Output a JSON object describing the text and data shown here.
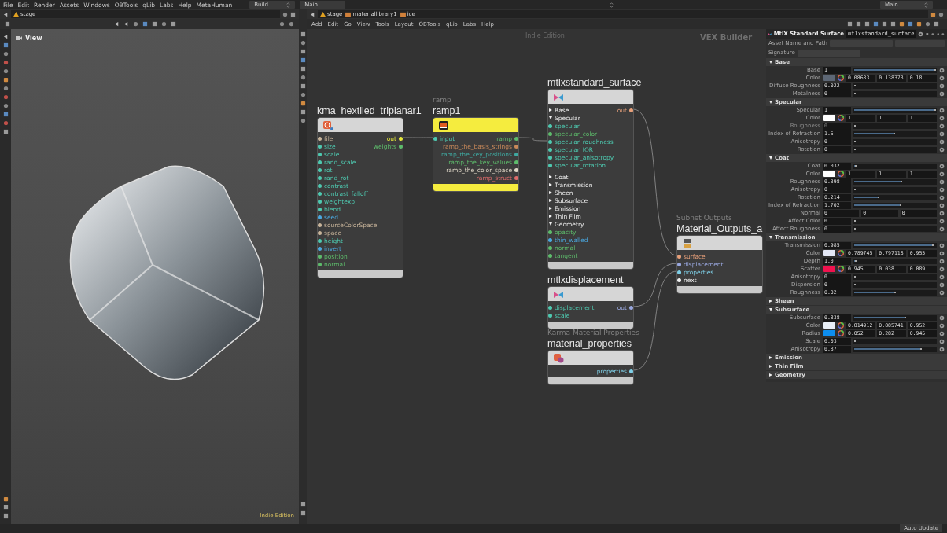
{
  "menu_bar": {
    "items": [
      "File",
      "Edit",
      "Render",
      "Assets",
      "Windows",
      "OBTools",
      "qLib",
      "Labs",
      "Help",
      "MetaHuman"
    ],
    "desktop": "Build",
    "pane_tab": "Main",
    "right_pane_tab": "Main"
  },
  "viewport": {
    "path": "stage",
    "title": "View",
    "edition": "Indie Edition"
  },
  "network": {
    "path": [
      "stage",
      "materiallibrary1",
      "ice"
    ],
    "menu": [
      "Add",
      "Edit",
      "Go",
      "View",
      "Tools",
      "Layout",
      "OBTools",
      "qLib",
      "Labs",
      "Help"
    ],
    "edition": "Indie Edition",
    "context": "VEX Builder",
    "nodes": [
      {
        "kind": "texture",
        "name": "kma_hextiled_triplanar1",
        "rows": [
          {
            "kind": "port",
            "input": {
              "label": "file",
              "color": "#c8b49a"
            },
            "output": {
              "label": "out",
              "color": "#e5e83a"
            }
          },
          {
            "kind": "port",
            "input": {
              "label": "size",
              "color": "#4ec9b0"
            },
            "output": {
              "label": "weights",
              "color": "#5dbb6b"
            }
          },
          {
            "kind": "port",
            "input": {
              "label": "scale",
              "color": "#4ec9b0"
            }
          },
          {
            "kind": "port",
            "input": {
              "label": "rand_scale",
              "color": "#4ec9b0"
            }
          },
          {
            "kind": "port",
            "input": {
              "label": "rot",
              "color": "#4ec9b0"
            }
          },
          {
            "kind": "port",
            "input": {
              "label": "rand_rot",
              "color": "#4ec9b0"
            }
          },
          {
            "kind": "port",
            "input": {
              "label": "contrast",
              "color": "#4ec9b0"
            }
          },
          {
            "kind": "port",
            "input": {
              "label": "contrast_falloff",
              "color": "#4ec9b0"
            }
          },
          {
            "kind": "port",
            "input": {
              "label": "weightexp",
              "color": "#4ec9b0"
            }
          },
          {
            "kind": "port",
            "input": {
              "label": "blend",
              "color": "#4ec9b0"
            }
          },
          {
            "kind": "port",
            "input": {
              "label": "seed",
              "color": "#4aa8e0"
            }
          },
          {
            "kind": "port",
            "input": {
              "label": "sourceColorSpace",
              "color": "#c8b49a"
            }
          },
          {
            "kind": "port",
            "input": {
              "label": "space",
              "color": "#c8b49a"
            }
          },
          {
            "kind": "port",
            "input": {
              "label": "height",
              "color": "#4ec9b0"
            }
          },
          {
            "kind": "port",
            "input": {
              "label": "invert",
              "color": "#4aa8e0"
            }
          },
          {
            "kind": "port",
            "input": {
              "label": "position",
              "color": "#5dbb6b"
            }
          },
          {
            "kind": "port",
            "input": {
              "label": "normal",
              "color": "#5dbb6b"
            }
          }
        ]
      },
      {
        "kind": "ramp",
        "subtitle": "ramp",
        "name": "ramp1",
        "color": "#f5ec3e",
        "rows": [
          {
            "kind": "port",
            "input": {
              "label": "input",
              "color": "#4ec9b0"
            },
            "output": {
              "label": "ramp",
              "color": "#5dbb6b"
            }
          },
          {
            "kind": "port",
            "output": {
              "label": "ramp_the_basis_strings",
              "color": "#c8895a"
            }
          },
          {
            "kind": "port",
            "output": {
              "label": "ramp_the_key_positions",
              "color": "#3fa8a0"
            }
          },
          {
            "kind": "port",
            "output": {
              "label": "ramp_the_key_values",
              "color": "#5dbb6b"
            }
          },
          {
            "kind": "port",
            "output": {
              "label": "ramp_the_color_space",
              "color": "#e0d8c8"
            }
          },
          {
            "kind": "port",
            "output": {
              "label": "ramp_struct",
              "color": "#e06c6c"
            }
          }
        ]
      },
      {
        "kind": "materialx",
        "name": "mtlxstandard_surface",
        "rows": [
          {
            "kind": "section",
            "label": "Base",
            "expanded": false,
            "output": {
              "label": "out",
              "color": "#e8a07a"
            }
          },
          {
            "kind": "section",
            "label": "Specular",
            "expanded": true
          },
          {
            "kind": "port",
            "input": {
              "label": "specular",
              "color": "#4ec9b0"
            }
          },
          {
            "kind": "port",
            "input": {
              "label": "specular_color",
              "color": "#5dbb6b"
            }
          },
          {
            "kind": "port",
            "input": {
              "label": "specular_roughness",
              "color": "#4ec9b0"
            }
          },
          {
            "kind": "port",
            "input": {
              "label": "specular_IOR",
              "color": "#4ec9b0"
            }
          },
          {
            "kind": "port",
            "input": {
              "label": "specular_anisotropy",
              "color": "#4ec9b0"
            }
          },
          {
            "kind": "port",
            "input": {
              "label": "specular_rotation",
              "color": "#4ec9b0"
            }
          },
          {
            "kind": "section",
            "label": "Coat",
            "expanded": false
          },
          {
            "kind": "section",
            "label": "Transmission",
            "expanded": false
          },
          {
            "kind": "section",
            "label": "Sheen",
            "expanded": false
          },
          {
            "kind": "section",
            "label": "Subsurface",
            "expanded": false
          },
          {
            "kind": "section",
            "label": "Emission",
            "expanded": false
          },
          {
            "kind": "section",
            "label": "Thin Film",
            "expanded": false
          },
          {
            "kind": "section",
            "label": "Geometry",
            "expanded": true
          },
          {
            "kind": "port",
            "input": {
              "label": "opacity",
              "color": "#5dbb6b"
            }
          },
          {
            "kind": "port",
            "input": {
              "label": "thin_walled",
              "color": "#4aa8e0"
            }
          },
          {
            "kind": "port",
            "input": {
              "label": "normal",
              "color": "#5dbb6b"
            }
          },
          {
            "kind": "port",
            "input": {
              "label": "tangent",
              "color": "#5dbb6b"
            }
          }
        ]
      },
      {
        "kind": "materialx",
        "name": "mtlxdisplacement",
        "rows": [
          {
            "kind": "port",
            "input": {
              "label": "displacement",
              "color": "#4ec9b0"
            },
            "output": {
              "label": "out",
              "color": "#9aa8e0"
            }
          },
          {
            "kind": "port",
            "input": {
              "label": "scale",
              "color": "#4ec9b0"
            }
          }
        ]
      },
      {
        "kind": "properties",
        "subtitle": "Karma Material Properties",
        "name": "material_properties",
        "rows": [
          {
            "kind": "port",
            "output": {
              "label": "properties",
              "color": "#7fd0e8"
            }
          }
        ]
      },
      {
        "kind": "output",
        "subtitle": "Subnet Outputs",
        "name": "Material_Outputs_a",
        "rows": [
          {
            "kind": "port",
            "input": {
              "label": "surface",
              "color": "#e8a07a"
            }
          },
          {
            "kind": "port",
            "input": {
              "label": "displacement",
              "color": "#9aa8e0"
            }
          },
          {
            "kind": "port",
            "input": {
              "label": "properties",
              "color": "#7fd0e8"
            }
          },
          {
            "kind": "port",
            "input": {
              "label": "next",
              "color": "#f0f0f0"
            }
          }
        ]
      }
    ]
  },
  "parameters": {
    "type": "MtlX Standard Surface",
    "name": "mtlxstandard_surface",
    "asset_label": "Asset Name and Path",
    "signature_label": "Signature",
    "sections": [
      {
        "title": "Base",
        "expanded": true,
        "rows": [
          {
            "kind": "slider",
            "label": "Base",
            "value": "1",
            "level": 1,
            "disabled": false
          },
          {
            "kind": "color",
            "label": "Color",
            "color": "#5d6775",
            "values": [
              "0.08633",
              "0.138373",
              "0.18"
            ],
            "disabled": false
          },
          {
            "kind": "slider",
            "label": "Diffuse Roughness",
            "value": "0.022",
            "level": 0.02,
            "disabled": false
          },
          {
            "kind": "slider",
            "label": "Metalness",
            "value": "0",
            "level": 0,
            "disabled": false
          }
        ]
      },
      {
        "title": "Specular",
        "expanded": true,
        "rows": [
          {
            "kind": "slider",
            "label": "Specular",
            "value": "1",
            "level": 1,
            "disabled": false
          },
          {
            "kind": "color",
            "label": "Color",
            "color": "#ffffff",
            "values": [
              "1",
              "1",
              "1"
            ],
            "disabled": false
          },
          {
            "kind": "slider",
            "label": "Roughness",
            "value": "0",
            "level": 0,
            "disabled": true
          },
          {
            "kind": "slider",
            "label": "Index of Refraction",
            "value": "1.5",
            "level": 0.5,
            "disabled": false
          },
          {
            "kind": "slider",
            "label": "Anisotropy",
            "value": "0",
            "level": 0,
            "disabled": false
          },
          {
            "kind": "slider",
            "label": "Rotation",
            "value": "0",
            "level": 0,
            "disabled": false
          }
        ]
      },
      {
        "title": "Coat",
        "expanded": true,
        "rows": [
          {
            "kind": "slider",
            "label": "Coat",
            "value": "0.032",
            "level": 0.03,
            "disabled": false
          },
          {
            "kind": "color",
            "label": "Color",
            "color": "#ffffff",
            "values": [
              "1",
              "1",
              "1"
            ],
            "disabled": false
          },
          {
            "kind": "slider",
            "label": "Roughness",
            "value": "0.398",
            "level": 0.59,
            "disabled": false
          },
          {
            "kind": "slider",
            "label": "Anisotropy",
            "value": "0",
            "level": 0,
            "disabled": false
          },
          {
            "kind": "slider",
            "label": "Rotation",
            "value": "0.214",
            "level": 0.31,
            "disabled": false
          },
          {
            "kind": "slider",
            "label": "Index of Refraction",
            "value": "1.702",
            "level": 0.58,
            "disabled": false
          },
          {
            "kind": "vector",
            "label": "Normal",
            "values": [
              "0",
              "0",
              "0"
            ],
            "disabled": false
          },
          {
            "kind": "slider",
            "label": "Affect Color",
            "value": "0",
            "level": 0,
            "disabled": false
          },
          {
            "kind": "slider",
            "label": "Affect Roughness",
            "value": "0",
            "level": 0,
            "disabled": false
          }
        ]
      },
      {
        "title": "Transmission",
        "expanded": true,
        "rows": [
          {
            "kind": "slider",
            "label": "Transmission",
            "value": "0.985",
            "level": 0.97,
            "disabled": false
          },
          {
            "kind": "color",
            "label": "Color",
            "color": "#e4e8f6",
            "values": [
              "0.789745",
              "0.797118",
              "0.955"
            ],
            "disabled": false
          },
          {
            "kind": "slider",
            "label": "Depth",
            "value": "1.0",
            "level": 0.03,
            "disabled": false
          },
          {
            "kind": "color",
            "label": "Scatter",
            "color": "#f0124e",
            "values": [
              "0.945",
              "0.038",
              "0.089"
            ],
            "disabled": false
          },
          {
            "kind": "slider",
            "label": "Anisotropy",
            "value": "0",
            "level": 0,
            "disabled": false
          },
          {
            "kind": "slider",
            "label": "Dispersion",
            "value": "0",
            "level": 0,
            "disabled": false
          },
          {
            "kind": "slider",
            "label": "Roughness",
            "value": "0.02",
            "level": 0.51,
            "disabled": false
          }
        ]
      },
      {
        "title": "Sheen",
        "expanded": false
      },
      {
        "title": "Subsurface",
        "expanded": true,
        "rows": [
          {
            "kind": "slider",
            "label": "Subsurface",
            "value": "0.838",
            "level": 0.63,
            "disabled": false
          },
          {
            "kind": "color",
            "label": "Color",
            "color": "#e8eef6",
            "values": [
              "0.814912",
              "0.885741",
              "0.952"
            ],
            "disabled": false
          },
          {
            "kind": "color",
            "label": "Radius",
            "color": "#0d8ef0",
            "values": [
              "0.052",
              "0.282",
              "0.945"
            ],
            "disabled": false
          },
          {
            "kind": "slider",
            "label": "Scale",
            "value": "0.03",
            "level": 0,
            "disabled": false
          },
          {
            "kind": "slider",
            "label": "Anisotropy",
            "value": "0.87",
            "level": 0.83,
            "disabled": false
          }
        ]
      },
      {
        "title": "Emission",
        "expanded": false
      },
      {
        "title": "Thin Film",
        "expanded": false
      },
      {
        "title": "Geometry",
        "expanded": false
      }
    ]
  },
  "status_bar": {
    "button": "Auto Update"
  }
}
